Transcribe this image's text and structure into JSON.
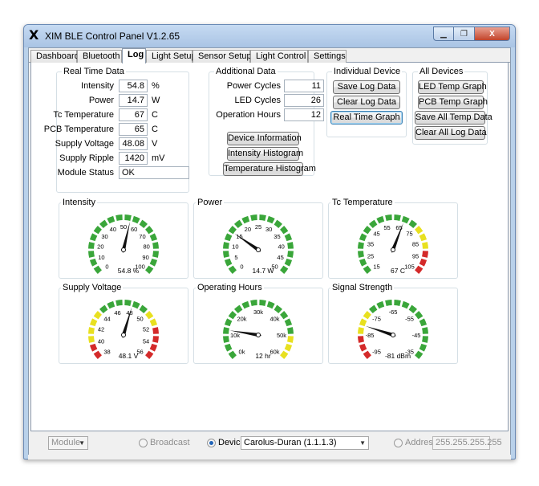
{
  "window": {
    "icon_glyph": "X",
    "title": "XIM BLE Control Panel V1.2.65",
    "min_glyph": "▁",
    "max_glyph": "❐",
    "close_glyph": "X"
  },
  "tabs": [
    {
      "label": "Dashboard",
      "active": false
    },
    {
      "label": "Bluetooth",
      "active": false
    },
    {
      "label": "Log",
      "active": true
    },
    {
      "label": "Light Setup",
      "active": false
    },
    {
      "label": "Sensor Setup",
      "active": false
    },
    {
      "label": "Light Control",
      "active": false
    },
    {
      "label": "Settings",
      "active": false
    }
  ],
  "real_time": {
    "title": "Real Time Data",
    "rows": [
      {
        "label": "Intensity",
        "value": "54.8",
        "unit": "%"
      },
      {
        "label": "Power",
        "value": "14.7",
        "unit": "W"
      },
      {
        "label": "Tc Temperature",
        "value": "67",
        "unit": "C"
      },
      {
        "label": "PCB Temperature",
        "value": "65",
        "unit": "C"
      },
      {
        "label": "Supply Voltage",
        "value": "48.08",
        "unit": "V"
      },
      {
        "label": "Supply Ripple",
        "value": "1420",
        "unit": "mV"
      },
      {
        "label": "Module Status",
        "value": "OK",
        "unit": ""
      }
    ]
  },
  "additional": {
    "title": "Additional Data",
    "rows": [
      {
        "label": "Power Cycles",
        "value": "11"
      },
      {
        "label": "LED Cycles",
        "value": "26"
      },
      {
        "label": "Operation Hours",
        "value": "12"
      }
    ],
    "buttons": [
      "Device Information",
      "Intensity Histogram",
      "Temperature Histogram"
    ]
  },
  "individual": {
    "title": "Individual Device",
    "buttons": [
      "Save Log Data",
      "Clear Log Data",
      "Real Time Graph"
    ]
  },
  "all_devices": {
    "title": "All Devices",
    "buttons": [
      "LED Temp Graph",
      "PCB Temp Graph",
      "Save All Temp Data",
      "Clear All Log Data"
    ]
  },
  "gauges": [
    {
      "title": "Intensity",
      "min": 0,
      "max": 100,
      "value": 54.8,
      "readout": "54.8 %",
      "labels": [
        "0",
        "10",
        "20",
        "30",
        "40",
        "50",
        "60",
        "70",
        "80",
        "90",
        "100"
      ],
      "zones": [
        {
          "from": 0,
          "to": 100,
          "color": "#3aa63a"
        }
      ]
    },
    {
      "title": "Power",
      "min": 0,
      "max": 50,
      "value": 14.7,
      "readout": "14.7 W",
      "labels": [
        "0",
        "5",
        "10",
        "15",
        "20",
        "25",
        "30",
        "35",
        "40",
        "45",
        "50"
      ],
      "zones": [
        {
          "from": 0,
          "to": 50,
          "color": "#3aa63a"
        }
      ]
    },
    {
      "title": "Tc Temperature",
      "min": 15,
      "max": 105,
      "value": 67,
      "readout": "67 C",
      "labels": [
        "15",
        "25",
        "35",
        "45",
        "55",
        "65",
        "75",
        "85",
        "95",
        "105"
      ],
      "zones": [
        {
          "from": 15,
          "to": 75,
          "color": "#3aa63a"
        },
        {
          "from": 75,
          "to": 90,
          "color": "#e8e020"
        },
        {
          "from": 90,
          "to": 105,
          "color": "#d42a2a"
        }
      ]
    },
    {
      "title": "Supply Voltage",
      "min": 38,
      "max": 56,
      "value": 48.1,
      "readout": "48.1 V",
      "labels": [
        "38",
        "40",
        "42",
        "44",
        "46",
        "48",
        "50",
        "52",
        "54",
        "56"
      ],
      "zones": [
        {
          "from": 38,
          "to": 40,
          "color": "#d42a2a"
        },
        {
          "from": 40,
          "to": 44,
          "color": "#e8e020"
        },
        {
          "from": 44,
          "to": 50,
          "color": "#3aa63a"
        },
        {
          "from": 50,
          "to": 52,
          "color": "#e8e020"
        },
        {
          "from": 52,
          "to": 56,
          "color": "#d42a2a"
        }
      ]
    },
    {
      "title": "Operating Hours",
      "min": 0,
      "max": 60,
      "value": 12,
      "readout": "12 hr",
      "labels": [
        "0k",
        "10k",
        "20k",
        "30k",
        "40k",
        "50k",
        "60k"
      ],
      "zones": [
        {
          "from": 0,
          "to": 50,
          "color": "#3aa63a"
        },
        {
          "from": 50,
          "to": 60,
          "color": "#e8e020"
        }
      ]
    },
    {
      "title": "Signal Strength",
      "min": -95,
      "max": -35,
      "value": -81,
      "readout": "-81 dBm",
      "labels": [
        "-95",
        "-85",
        "-75",
        "-65",
        "-55",
        "-45",
        "-35"
      ],
      "zones": [
        {
          "from": -95,
          "to": -85,
          "color": "#d42a2a"
        },
        {
          "from": -85,
          "to": -75,
          "color": "#e8e020"
        },
        {
          "from": -75,
          "to": -35,
          "color": "#3aa63a"
        }
      ]
    }
  ],
  "bottom": {
    "module_select": "Module",
    "broadcast_label": "Broadcast",
    "device_label": "Device",
    "device_select": "Carolus-Duran (1.1.1.3)",
    "address_label": "Address",
    "address_value": "255.255.255.255"
  }
}
